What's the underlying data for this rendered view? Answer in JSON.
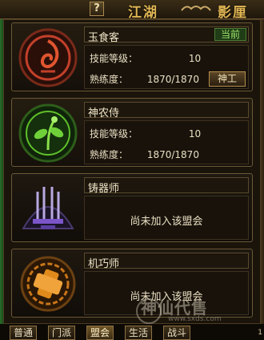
{
  "topbar": {
    "help_label": "?",
    "title_left": "江湖",
    "title_right": "影厘"
  },
  "professions": [
    {
      "name": "玉食客",
      "current_tag": "当前",
      "skill_level_label": "技能等级：",
      "skill_level_value": "10",
      "proficiency_label": "熟练度：",
      "proficiency_value": "1870/1870",
      "button": "神工",
      "emblem_color": "#c3402a",
      "emblem_icon": "flame-swirl-icon"
    },
    {
      "name": "神农侍",
      "skill_level_label": "技能等级：",
      "skill_level_value": "10",
      "proficiency_label": "熟练度：",
      "proficiency_value": "1870/1870",
      "emblem_color": "#5fbf2a",
      "emblem_icon": "herb-leaf-icon"
    },
    {
      "name": "铸器师",
      "status": "尚未加入该盟会",
      "emblem_color": "#7b55c9",
      "emblem_icon": "weapon-forge-icon"
    },
    {
      "name": "机巧师",
      "status": "尚未加入该盟会",
      "emblem_color": "#e08a1c",
      "emblem_icon": "gear-cross-icon"
    }
  ],
  "tabs": [
    "普通",
    "门派",
    "盟会",
    "生活",
    "战斗"
  ],
  "tab_page": "1",
  "watermark": {
    "text": "神仙代售",
    "url": "www.sxds.com"
  }
}
